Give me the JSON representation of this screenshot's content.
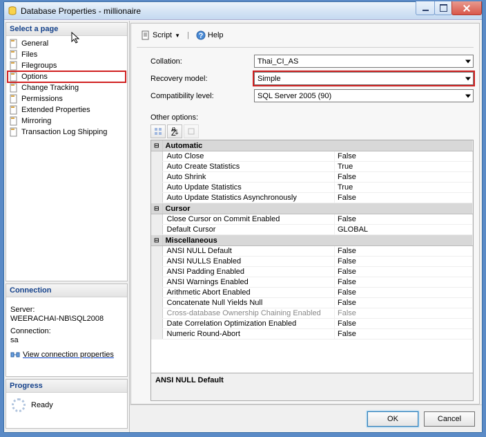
{
  "window": {
    "title": "Database Properties - millionaire"
  },
  "sidebar": {
    "select_page_header": "Select a page",
    "items": [
      {
        "label": "General"
      },
      {
        "label": "Files"
      },
      {
        "label": "Filegroups"
      },
      {
        "label": "Options",
        "selected": true
      },
      {
        "label": "Change Tracking"
      },
      {
        "label": "Permissions"
      },
      {
        "label": "Extended Properties"
      },
      {
        "label": "Mirroring"
      },
      {
        "label": "Transaction Log Shipping"
      }
    ],
    "connection_header": "Connection",
    "server_label": "Server:",
    "server_value": "WEERACHAI-NB\\SQL2008",
    "connection_label": "Connection:",
    "connection_value": "sa",
    "view_conn_props": "View connection properties",
    "progress_header": "Progress",
    "progress_status": "Ready"
  },
  "toolbar": {
    "script_label": "Script",
    "help_label": "Help"
  },
  "form": {
    "collation_label": "Collation:",
    "collation_value": "Thai_CI_AS",
    "recovery_label": "Recovery model:",
    "recovery_value": "Simple",
    "compat_label": "Compatibility level:",
    "compat_value": "SQL Server 2005 (90)"
  },
  "other_options_label": "Other options:",
  "grid": {
    "categories": [
      {
        "name": "Automatic",
        "rows": [
          {
            "key": "Auto Close",
            "value": "False"
          },
          {
            "key": "Auto Create Statistics",
            "value": "True"
          },
          {
            "key": "Auto Shrink",
            "value": "False"
          },
          {
            "key": "Auto Update Statistics",
            "value": "True"
          },
          {
            "key": "Auto Update Statistics Asynchronously",
            "value": "False"
          }
        ]
      },
      {
        "name": "Cursor",
        "rows": [
          {
            "key": "Close Cursor on Commit Enabled",
            "value": "False"
          },
          {
            "key": "Default Cursor",
            "value": "GLOBAL"
          }
        ]
      },
      {
        "name": "Miscellaneous",
        "rows": [
          {
            "key": "ANSI NULL Default",
            "value": "False"
          },
          {
            "key": "ANSI NULLS Enabled",
            "value": "False"
          },
          {
            "key": "ANSI Padding Enabled",
            "value": "False"
          },
          {
            "key": "ANSI Warnings Enabled",
            "value": "False"
          },
          {
            "key": "Arithmetic Abort Enabled",
            "value": "False"
          },
          {
            "key": "Concatenate Null Yields Null",
            "value": "False"
          },
          {
            "key": "Cross-database Ownership Chaining Enabled",
            "value": "False",
            "dim": true
          },
          {
            "key": "Date Correlation Optimization Enabled",
            "value": "False"
          },
          {
            "key": "Numeric Round-Abort",
            "value": "False"
          }
        ]
      }
    ],
    "description_title": "ANSI NULL Default"
  },
  "footer": {
    "ok": "OK",
    "cancel": "Cancel"
  }
}
